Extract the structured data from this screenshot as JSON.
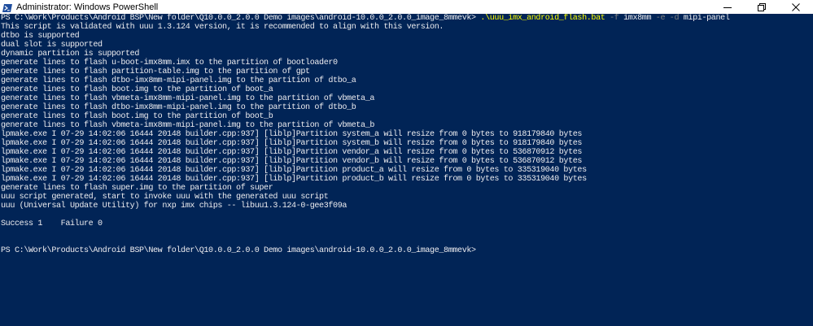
{
  "window": {
    "title": "Administrator: Windows PowerShell",
    "icon": "powershell-icon",
    "controls": [
      "minimize-icon",
      "maximize-icon",
      "close-icon"
    ]
  },
  "colors": {
    "console_background": "#012456",
    "text": "#eeedf0",
    "command": "#ffff00",
    "parameter": "#808080"
  },
  "console": {
    "prompt_1": "PS C:\\Work\\Products\\Android BSP\\New folder\\Q10.0.0_2.0.0 Demo images\\android-10.0.0_2.0.0_image_8mmevk> ",
    "command_1": {
      "exe": ".\\uuu_imx_android_flash.bat",
      "sp1": " ",
      "flag_f": "-f",
      "arg_f": " imx8mm ",
      "flag_e": "-e",
      "sp2": " ",
      "flag_d": "-d",
      "arg_d": " mipi-panel"
    },
    "output": [
      "This script is validated with uuu 1.3.124 version, it is recommended to align with this version.",
      "dtbo is supported",
      "dual slot is supported",
      "dynamic partition is supported",
      "generate lines to flash u-boot-imx8mm.imx to the partition of bootloader0",
      "generate lines to flash partition-table.img to the partition of gpt",
      "generate lines to flash dtbo-imx8mm-mipi-panel.img to the partition of dtbo_a",
      "generate lines to flash boot.img to the partition of boot_a",
      "generate lines to flash vbmeta-imx8mm-mipi-panel.img to the partition of vbmeta_a",
      "generate lines to flash dtbo-imx8mm-mipi-panel.img to the partition of dtbo_b",
      "generate lines to flash boot.img to the partition of boot_b",
      "generate lines to flash vbmeta-imx8mm-mipi-panel.img to the partition of vbmeta_b",
      "lpmake.exe I 07-29 14:02:06 16444 20148 builder.cpp:937] [liblp]Partition system_a will resize from 0 bytes to 918179840 bytes",
      "lpmake.exe I 07-29 14:02:06 16444 20148 builder.cpp:937] [liblp]Partition system_b will resize from 0 bytes to 918179840 bytes",
      "lpmake.exe I 07-29 14:02:06 16444 20148 builder.cpp:937] [liblp]Partition vendor_a will resize from 0 bytes to 536870912 bytes",
      "lpmake.exe I 07-29 14:02:06 16444 20148 builder.cpp:937] [liblp]Partition vendor_b will resize from 0 bytes to 536870912 bytes",
      "lpmake.exe I 07-29 14:02:06 16444 20148 builder.cpp:937] [liblp]Partition product_a will resize from 0 bytes to 335319040 bytes",
      "lpmake.exe I 07-29 14:02:06 16444 20148 builder.cpp:937] [liblp]Partition product_b will resize from 0 bytes to 335319040 bytes",
      "generate lines to flash super.img to the partition of super",
      "uuu script generated, start to invoke uuu with the generated uuu script",
      "uuu (Universal Update Utility) for nxp imx chips -- libuu1.3.124-0-gee3f09a",
      "",
      "Success 1    Failure 0",
      "",
      "",
      "PS C:\\Work\\Products\\Android BSP\\New folder\\Q10.0.0_2.0.0 Demo images\\android-10.0.0_2.0.0_image_8mmevk>"
    ]
  }
}
